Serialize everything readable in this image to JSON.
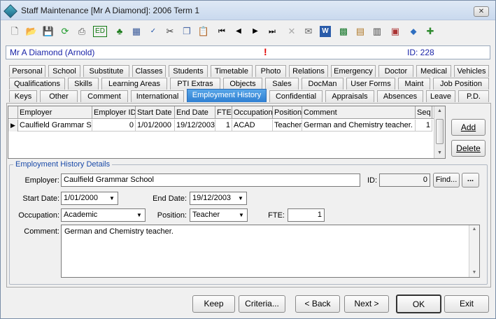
{
  "window": {
    "title": "Staff Maintenance  [Mr A Diamond]: 2006 Term 1",
    "close_glyph": "✕"
  },
  "toolbar": {
    "icons": [
      "new-icon",
      "open-icon",
      "save-icon",
      "refresh-icon",
      "print-icon",
      "edit-icon",
      "tree-icon",
      "calculator-icon",
      "spellcheck-icon",
      "cut-icon",
      "copy-icon",
      "paste-icon",
      "first-icon",
      "previous-icon",
      "next-icon",
      "last-icon",
      "delete-icon",
      "email-icon",
      "word-icon",
      "excel-icon",
      "report-icon",
      "export-icon",
      "import-icon",
      "tag-icon",
      "add-icon"
    ]
  },
  "header": {
    "person": "Mr A Diamond (Arnold)",
    "alert": "!",
    "id_text": "ID: 228"
  },
  "tabs": {
    "row1": [
      "Personal",
      "School",
      "Substitute",
      "Classes",
      "Students",
      "Timetable",
      "Photo",
      "Relations",
      "Emergency",
      "Doctor",
      "Medical",
      "Vehicles"
    ],
    "row2": [
      "Qualifications",
      "Skills",
      "Learning Areas",
      "PTI Extras",
      "Objects",
      "Sales",
      "DocMan",
      "User Forms",
      "Maint",
      "Job Position"
    ],
    "row3": [
      "Keys",
      "Other",
      "Comment",
      "International",
      "Employment History",
      "Confidential",
      "Appraisals",
      "Absences",
      "Leave",
      "P.D."
    ],
    "active": "Employment History"
  },
  "grid": {
    "columns": [
      "Employer",
      "Employer ID",
      "Start Date",
      "End Date",
      "FTE",
      "Occupation",
      "Position",
      "Comment",
      "Seq"
    ],
    "row_indicator": "▶",
    "rows": [
      [
        "Caulfield Grammar Sc",
        "0",
        "1/01/2000",
        "19/12/2003",
        "1",
        "ACAD",
        "Teacher",
        "German and Chemistry teacher.",
        "1"
      ]
    ]
  },
  "side_buttons": {
    "add": "Add",
    "delete": "Delete"
  },
  "details": {
    "legend": "Employment History Details",
    "employer_label": "Employer:",
    "employer_value": "Caulfield Grammar School",
    "id_label": "ID:",
    "id_value": "0",
    "find_button": "Find...",
    "more_button": "...",
    "start_label": "Start Date:",
    "start_value": "1/01/2000",
    "end_label": "End Date:",
    "end_value": "19/12/2003",
    "occupation_label": "Occupation:",
    "occupation_value": "Academic",
    "position_label": "Position:",
    "position_value": "Teacher",
    "fte_label": "FTE:",
    "fte_value": "1",
    "comment_label": "Comment:",
    "comment_value": "German and Chemistry teacher."
  },
  "footer": {
    "keep": "Keep",
    "criteria": "Criteria...",
    "back": "< Back",
    "next": "Next >",
    "ok": "OK",
    "exit": "Exit"
  }
}
